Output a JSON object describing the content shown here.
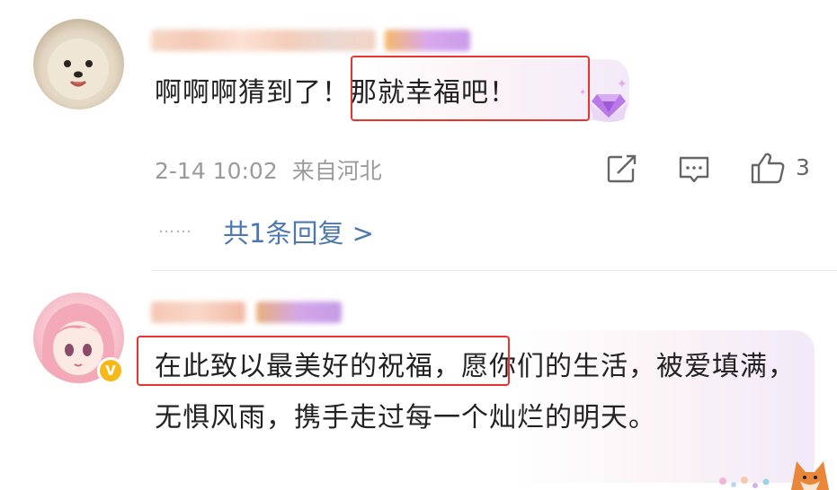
{
  "comment1": {
    "avatar_icon": "pomeranian-dog-avatar",
    "text_part1": "啊啊啊猜到了",
    "text_part2": "！那就幸福吧！",
    "badge_icon": "gem-badge-icon",
    "timestamp": "2-14 10:02",
    "location": "来自河北",
    "like_count": "3",
    "replies_dots": "……",
    "replies_link": "共1条回复 >"
  },
  "comment2": {
    "avatar_icon": "anime-girl-avatar",
    "verified_badge": "V",
    "text_highlighted": "在此致以最美好的祝福，",
    "text_rest": "愿你们的生活，被爱填满，无惧风雨，携手走过每一个灿烂的明天。",
    "sticker_icon": "fox-sticker-icon"
  },
  "colors": {
    "highlight_border": "#e5352e",
    "link": "#4d77b1",
    "meta_text": "#9b9b9b",
    "verified": "#f6b918"
  }
}
